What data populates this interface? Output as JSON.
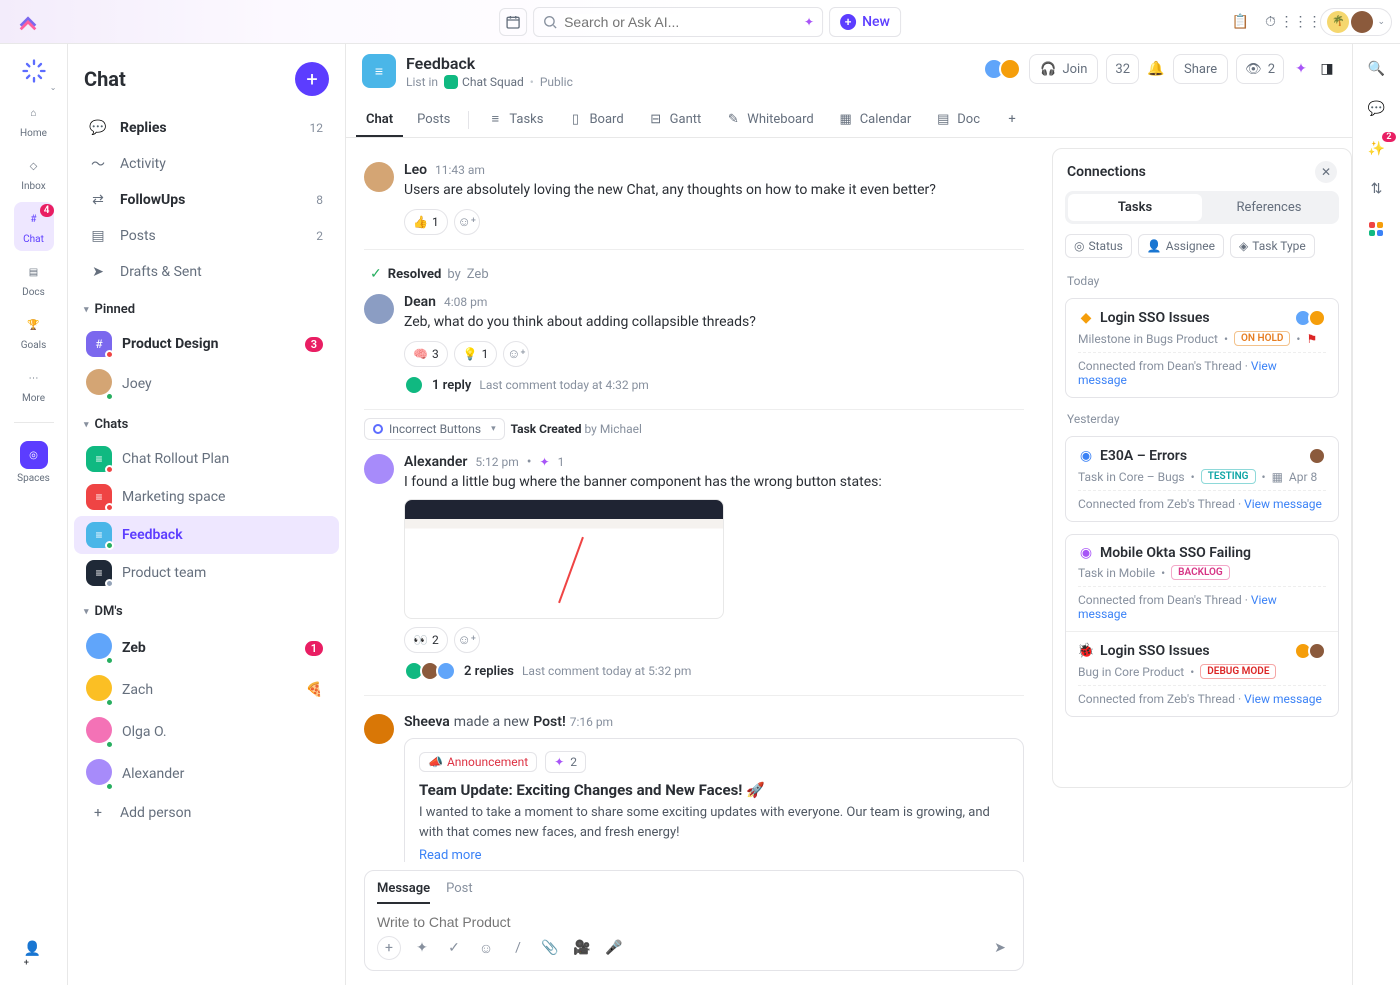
{
  "topbar": {
    "search_placeholder": "Search or Ask AI...",
    "new_label": "New"
  },
  "rail": {
    "home": "Home",
    "inbox": "Inbox",
    "chat": "Chat",
    "chat_badge": "4",
    "docs": "Docs",
    "goals": "Goals",
    "more": "More",
    "spaces": "Spaces"
  },
  "chat_sidebar": {
    "title": "Chat",
    "top": {
      "replies": {
        "label": "Replies",
        "count": "12"
      },
      "activity": {
        "label": "Activity"
      },
      "followups": {
        "label": "FollowUps",
        "count": "8"
      },
      "posts": {
        "label": "Posts",
        "count": "2"
      },
      "drafts": {
        "label": "Drafts & Sent"
      }
    },
    "pinned_title": "Pinned",
    "pinned": [
      {
        "label": "Product Design",
        "badge": "3"
      },
      {
        "label": "Joey"
      }
    ],
    "chats_title": "Chats",
    "chats": [
      {
        "label": "Chat Rollout Plan"
      },
      {
        "label": "Marketing space"
      },
      {
        "label": "Feedback",
        "active": true
      },
      {
        "label": "Product team"
      }
    ],
    "dms_title": "DM's",
    "dms": [
      {
        "label": "Zeb",
        "badge": "1"
      },
      {
        "label": "Zach"
      },
      {
        "label": "Olga O."
      },
      {
        "label": "Alexander"
      }
    ],
    "add_person": "Add person"
  },
  "header": {
    "title": "Feedback",
    "crumbs_prefix": "List in",
    "crumbs_space": "Chat Squad",
    "crumbs_visibility": "Public",
    "join": "Join",
    "count": "32",
    "share": "Share",
    "watchers": "2"
  },
  "tabs": {
    "chat": "Chat",
    "posts": "Posts",
    "tasks": "Tasks",
    "board": "Board",
    "gantt": "Gantt",
    "whiteboard": "Whiteboard",
    "calendar": "Calendar",
    "doc": "Doc"
  },
  "messages": [
    {
      "author": "Leo",
      "time": "11:43 am",
      "text": "Users are absolutely loving the new Chat, any thoughts on how to make it even better?",
      "reactions": [
        {
          "emoji": "👍",
          "count": "1"
        }
      ]
    },
    {
      "resolved_by": "Zeb",
      "author": "Dean",
      "time": "4:08 pm",
      "text": "Zeb, what do you think about adding collapsible threads?",
      "reactions": [
        {
          "emoji": "🧠",
          "count": "3"
        },
        {
          "emoji": "💡",
          "count": "1"
        }
      ],
      "reply_count": "1 reply",
      "reply_meta": "Last comment today at 4:32 pm"
    },
    {
      "task_chip": "Incorrect Buttons",
      "task_created_by": "Michael",
      "author": "Alexander",
      "time": "5:12 pm",
      "ai_count": "1",
      "text": "I found a little bug where the banner component has the wrong button states:",
      "has_image": true,
      "reactions": [
        {
          "emoji": "👀",
          "count": "2"
        }
      ],
      "reply_count": "2 replies",
      "reply_meta": "Last comment today at 5:32 pm"
    },
    {
      "author": "Sheeva",
      "post_verb": "made a new",
      "post_noun": "Post!",
      "time": "7:16 pm",
      "post_chip": "Announcement",
      "post_ai": "2",
      "post_title": "Team Update: Exciting Changes and New Faces! 🚀",
      "post_body": "I wanted to take a moment to share some exciting updates with everyone. Our team is growing, and with that comes new faces, and fresh energy!",
      "read_more": "Read more"
    }
  ],
  "resolved_label": "Resolved",
  "task_created_label": "Task Created",
  "by_label": "by",
  "composer": {
    "tab_message": "Message",
    "tab_post": "Post",
    "placeholder": "Write to Chat Product"
  },
  "connections": {
    "title": "Connections",
    "tab_tasks": "Tasks",
    "tab_refs": "References",
    "filter_status": "Status",
    "filter_assignee": "Assignee",
    "filter_type": "Task Type",
    "today": "Today",
    "yesterday": "Yesterday",
    "cards": [
      {
        "icon": "diamond",
        "icon_color": "#f59e0b",
        "title": "Login SSO Issues",
        "sub": "Milestone in Bugs Product",
        "status": "ON HOLD",
        "status_class": "st-onhold",
        "flag": true,
        "from": "Connected from Dean's Thread",
        "link": "View message",
        "avatars": 2
      },
      {
        "icon": "circle",
        "icon_color": "#3b82f6",
        "title": "E30A – Errors",
        "sub": "Task in Core – Bugs",
        "status": "TESTING",
        "status_class": "st-testing",
        "date": "Apr 8",
        "from": "Connected from Zeb's Thread",
        "link": "View message",
        "avatars": 1
      },
      {
        "icon": "circle",
        "icon_color": "#a855f7",
        "title": "Mobile Okta SSO Failing",
        "sub": "Task in Mobile",
        "status": "BACKLOG",
        "status_class": "st-backlog",
        "from": "Connected from Dean's Thread",
        "link": "View message"
      },
      {
        "icon": "bug",
        "icon_color": "#dc2626",
        "title": "Login SSO Issues",
        "sub": "Bug in Core Product",
        "status": "DEBUG MODE",
        "status_class": "st-debug",
        "from": "Connected from Zeb's Thread",
        "link": "View message",
        "avatars": 2
      }
    ]
  }
}
